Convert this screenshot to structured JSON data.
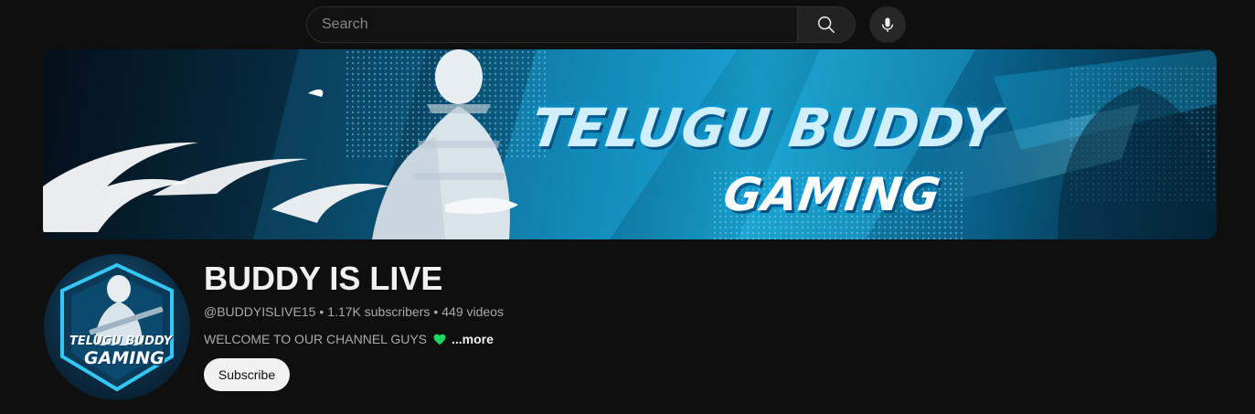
{
  "search": {
    "placeholder": "Search"
  },
  "icons": {
    "search": "search-icon",
    "mic": "microphone-icon",
    "heart": "green-heart-icon"
  },
  "banner": {
    "title": "TELUGU BUDDY",
    "subtitle": "GAMING"
  },
  "avatar": {
    "line1": "TELUGU BUDDY",
    "line2": "GAMING"
  },
  "channel": {
    "name": "BUDDY IS LIVE",
    "handle": "@BUDDYISLIVE15",
    "separator": "•",
    "subscribers": "1.17K subscribers",
    "videos": "449 videos",
    "description": "WELCOME TO OUR CHANNEL GUYS",
    "more_label": "...more",
    "subscribe_label": "Subscribe"
  },
  "colors": {
    "background": "#0f0f0f",
    "heart": "#1ed760",
    "banner_accent": "#1bb3e6"
  }
}
